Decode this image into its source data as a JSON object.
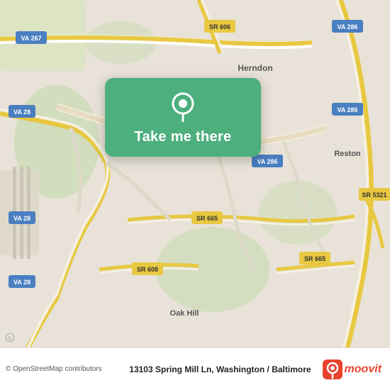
{
  "map": {
    "background_color": "#e0d8cc",
    "center_lat": 38.93,
    "center_lon": -77.38
  },
  "card": {
    "button_label": "Take me there",
    "pin_color": "#ffffff"
  },
  "bottom_bar": {
    "address": "13103 Spring Mill Ln, Washington / Baltimore",
    "osm_credit": "© OpenStreetMap contributors",
    "logo_text": "moovit"
  }
}
